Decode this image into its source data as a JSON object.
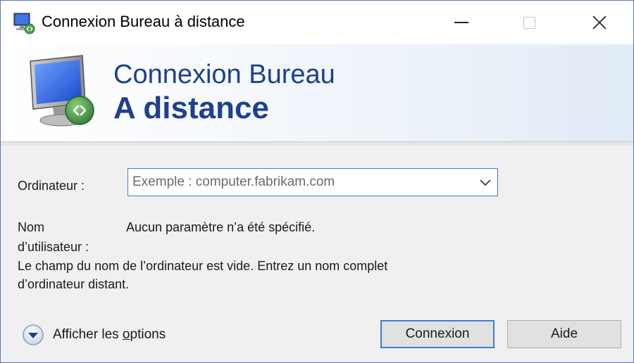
{
  "window": {
    "title": "Connexion Bureau à distance"
  },
  "banner": {
    "line1": "Connexion Bureau",
    "line2": "A distance"
  },
  "form": {
    "computer_label": "Ordinateur :",
    "computer_value": "",
    "computer_placeholder": "Exemple : computer.fabrikam.com",
    "username_label_line1": "Nom",
    "username_label_line2": "d’utilisateur :",
    "username_value": "Aucun paramètre n’a été spécifié.",
    "error_line1": "Le champ du nom de l’ordinateur est vide. Entrez un nom complet",
    "error_line2": "d’ordinateur distant."
  },
  "footer": {
    "show_options_prefix": "Afficher les ",
    "show_options_accel": "o",
    "show_options_suffix": "ptions",
    "connect_label": "Connexion",
    "help_label": "Aide"
  },
  "icons": {
    "app": "remote-desktop-icon",
    "minimize": "minimize-icon",
    "maximize": "maximize-icon",
    "close": "close-icon",
    "dropdown": "chevron-down-icon",
    "options": "expand-circle-icon"
  },
  "colors": {
    "banner_text": "#1f3f8f",
    "focus_border": "#3c7fcf"
  }
}
